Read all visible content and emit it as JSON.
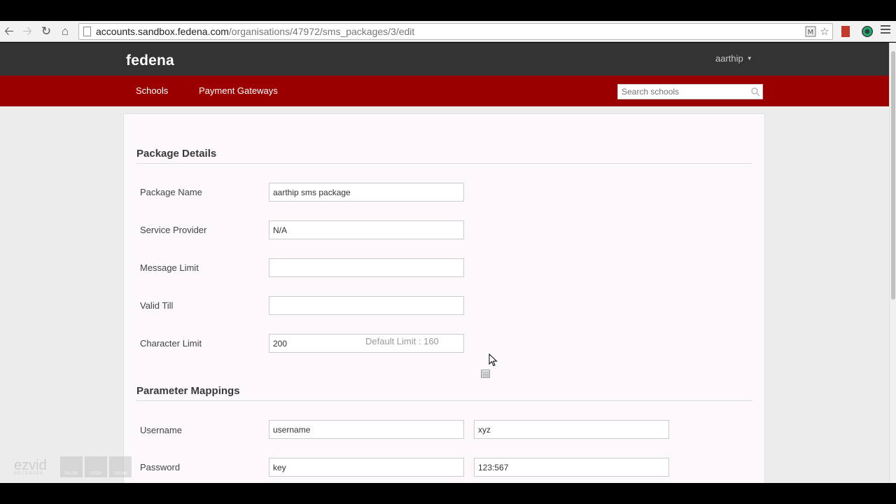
{
  "browser": {
    "url_host": "accounts.sandbox.fedena.com",
    "url_path": "/organisations/47972/sms_packages/3/edit"
  },
  "header": {
    "logo": "fedena",
    "user": "aarthip"
  },
  "nav": {
    "schools": "Schools",
    "payment_gateways": "Payment Gateways",
    "search_placeholder": "Search schools"
  },
  "package_details": {
    "title": "Package Details",
    "package_name_label": "Package Name",
    "package_name_value": "aarthip sms package",
    "service_provider_label": "Service Provider",
    "service_provider_value": "N/A",
    "message_limit_label": "Message Limit",
    "message_limit_value": "",
    "valid_till_label": "Valid Till",
    "valid_till_value": "",
    "character_limit_label": "Character Limit",
    "character_limit_value": "200",
    "default_limit_hint": "Default Limit : 160"
  },
  "parameter_mappings": {
    "title": "Parameter Mappings",
    "username_label": "Username",
    "username_key": "username",
    "username_value": "xyz",
    "password_label": "Password",
    "password_key": "key",
    "password_value": "123:567"
  },
  "watermark": {
    "logo": "ezvid",
    "sub": "RECORDER",
    "pause": "PAUSE",
    "stop": "STOP",
    "draw": "DRAW"
  }
}
